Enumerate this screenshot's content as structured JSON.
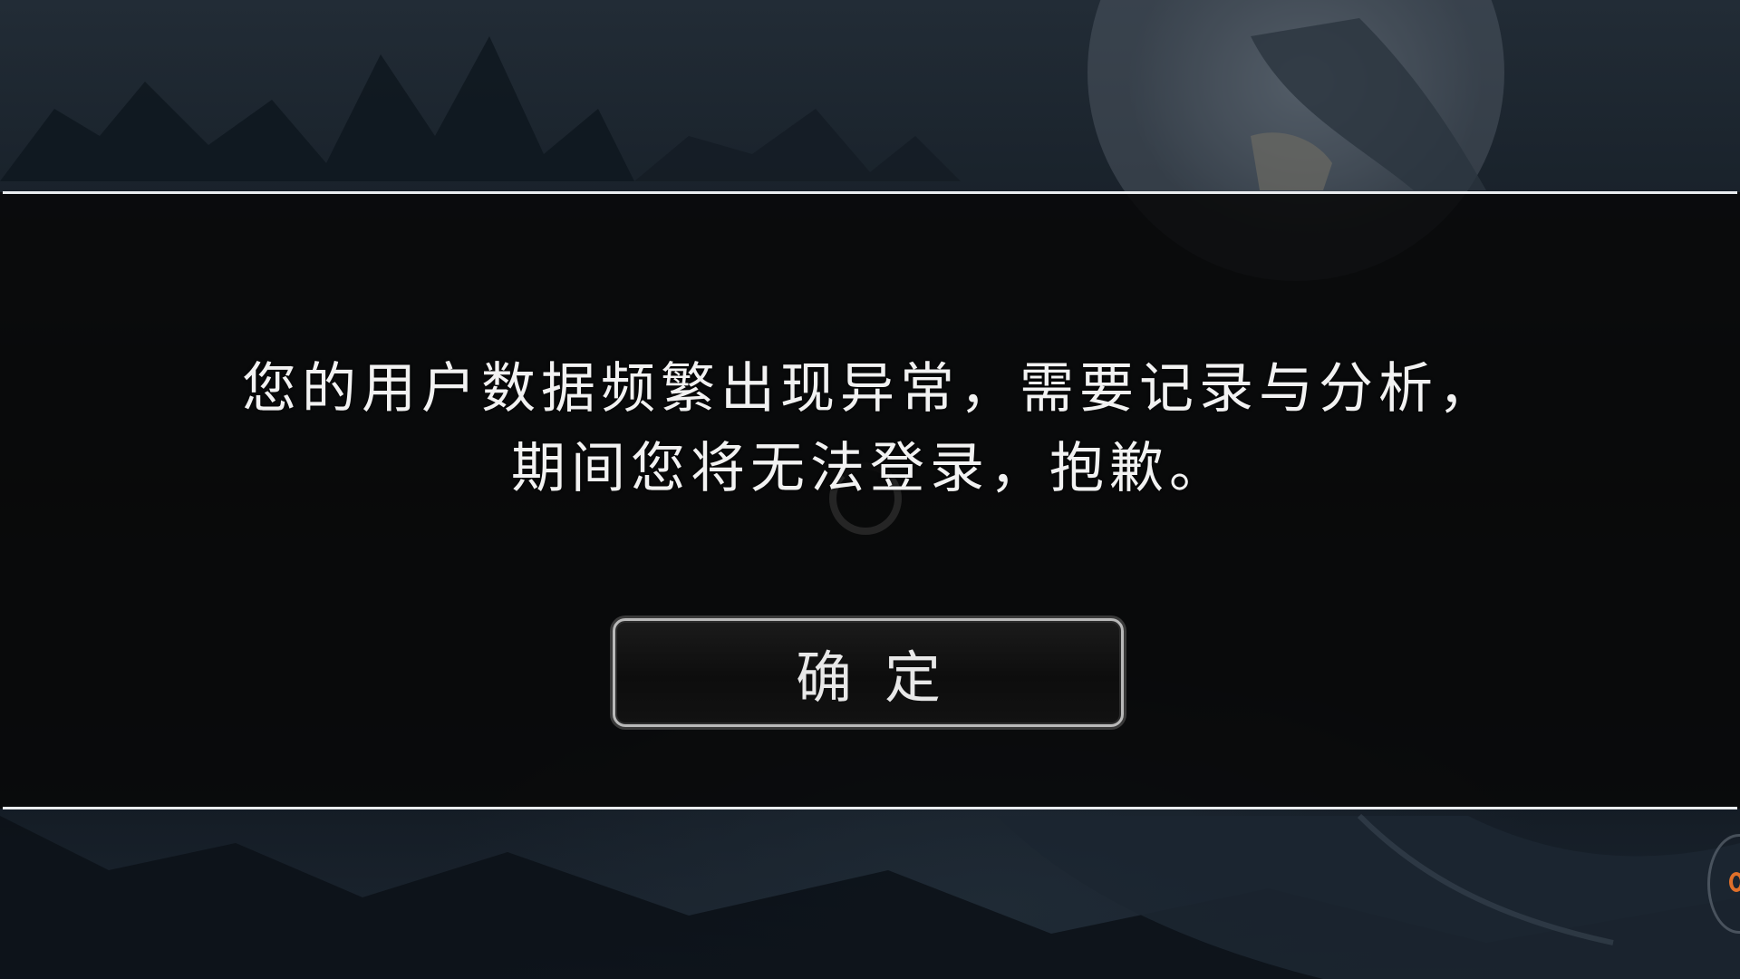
{
  "dialog": {
    "message_line1": "您的用户数据频繁出现异常，需要记录与分析，",
    "message_line2": "期间您将无法登录，抱歉。",
    "confirm_label": "确定"
  },
  "icons": {
    "loading": "loading-spinner-icon",
    "floating_widget": "floating-assistant-icon"
  },
  "colors": {
    "band_line": "#e9ecef",
    "message_text": "#f2f2f2",
    "button_border": "#b9b9b9",
    "widget_accent": "#e0702a"
  }
}
